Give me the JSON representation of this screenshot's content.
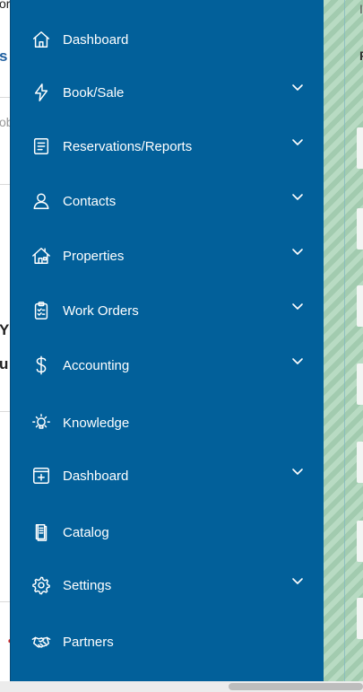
{
  "sidebar": {
    "items": [
      {
        "label": "Dashboard",
        "icon": "home-icon",
        "expandable": false
      },
      {
        "label": "Book/Sale",
        "icon": "lightning-icon",
        "expandable": true
      },
      {
        "label": "Reservations/Reports",
        "icon": "document-icon",
        "expandable": true
      },
      {
        "label": "Contacts",
        "icon": "person-icon",
        "expandable": true
      },
      {
        "label": "Properties",
        "icon": "house-icon",
        "expandable": true
      },
      {
        "label": "Work Orders",
        "icon": "clipboard-check-icon",
        "expandable": true
      },
      {
        "label": "Accounting",
        "icon": "dollar-icon",
        "expandable": true
      },
      {
        "label": "Knowledge",
        "icon": "lightbulb-icon",
        "expandable": false
      },
      {
        "label": "Dashboard",
        "icon": "window-plus-icon",
        "expandable": true
      },
      {
        "label": "Catalog",
        "icon": "catalog-icon",
        "expandable": false
      },
      {
        "label": "Settings",
        "icon": "gear-icon",
        "expandable": true
      },
      {
        "label": "Partners",
        "icon": "handshake-icon",
        "expandable": false
      }
    ]
  },
  "background": {
    "fragments": [
      "or",
      "s",
      "ob",
      "Y",
      "u"
    ],
    "right_letters": [
      "I",
      "F"
    ]
  },
  "colors": {
    "sidebar": "#02609a",
    "text": "#ffffff",
    "right_panel": "#a9d3b6"
  }
}
